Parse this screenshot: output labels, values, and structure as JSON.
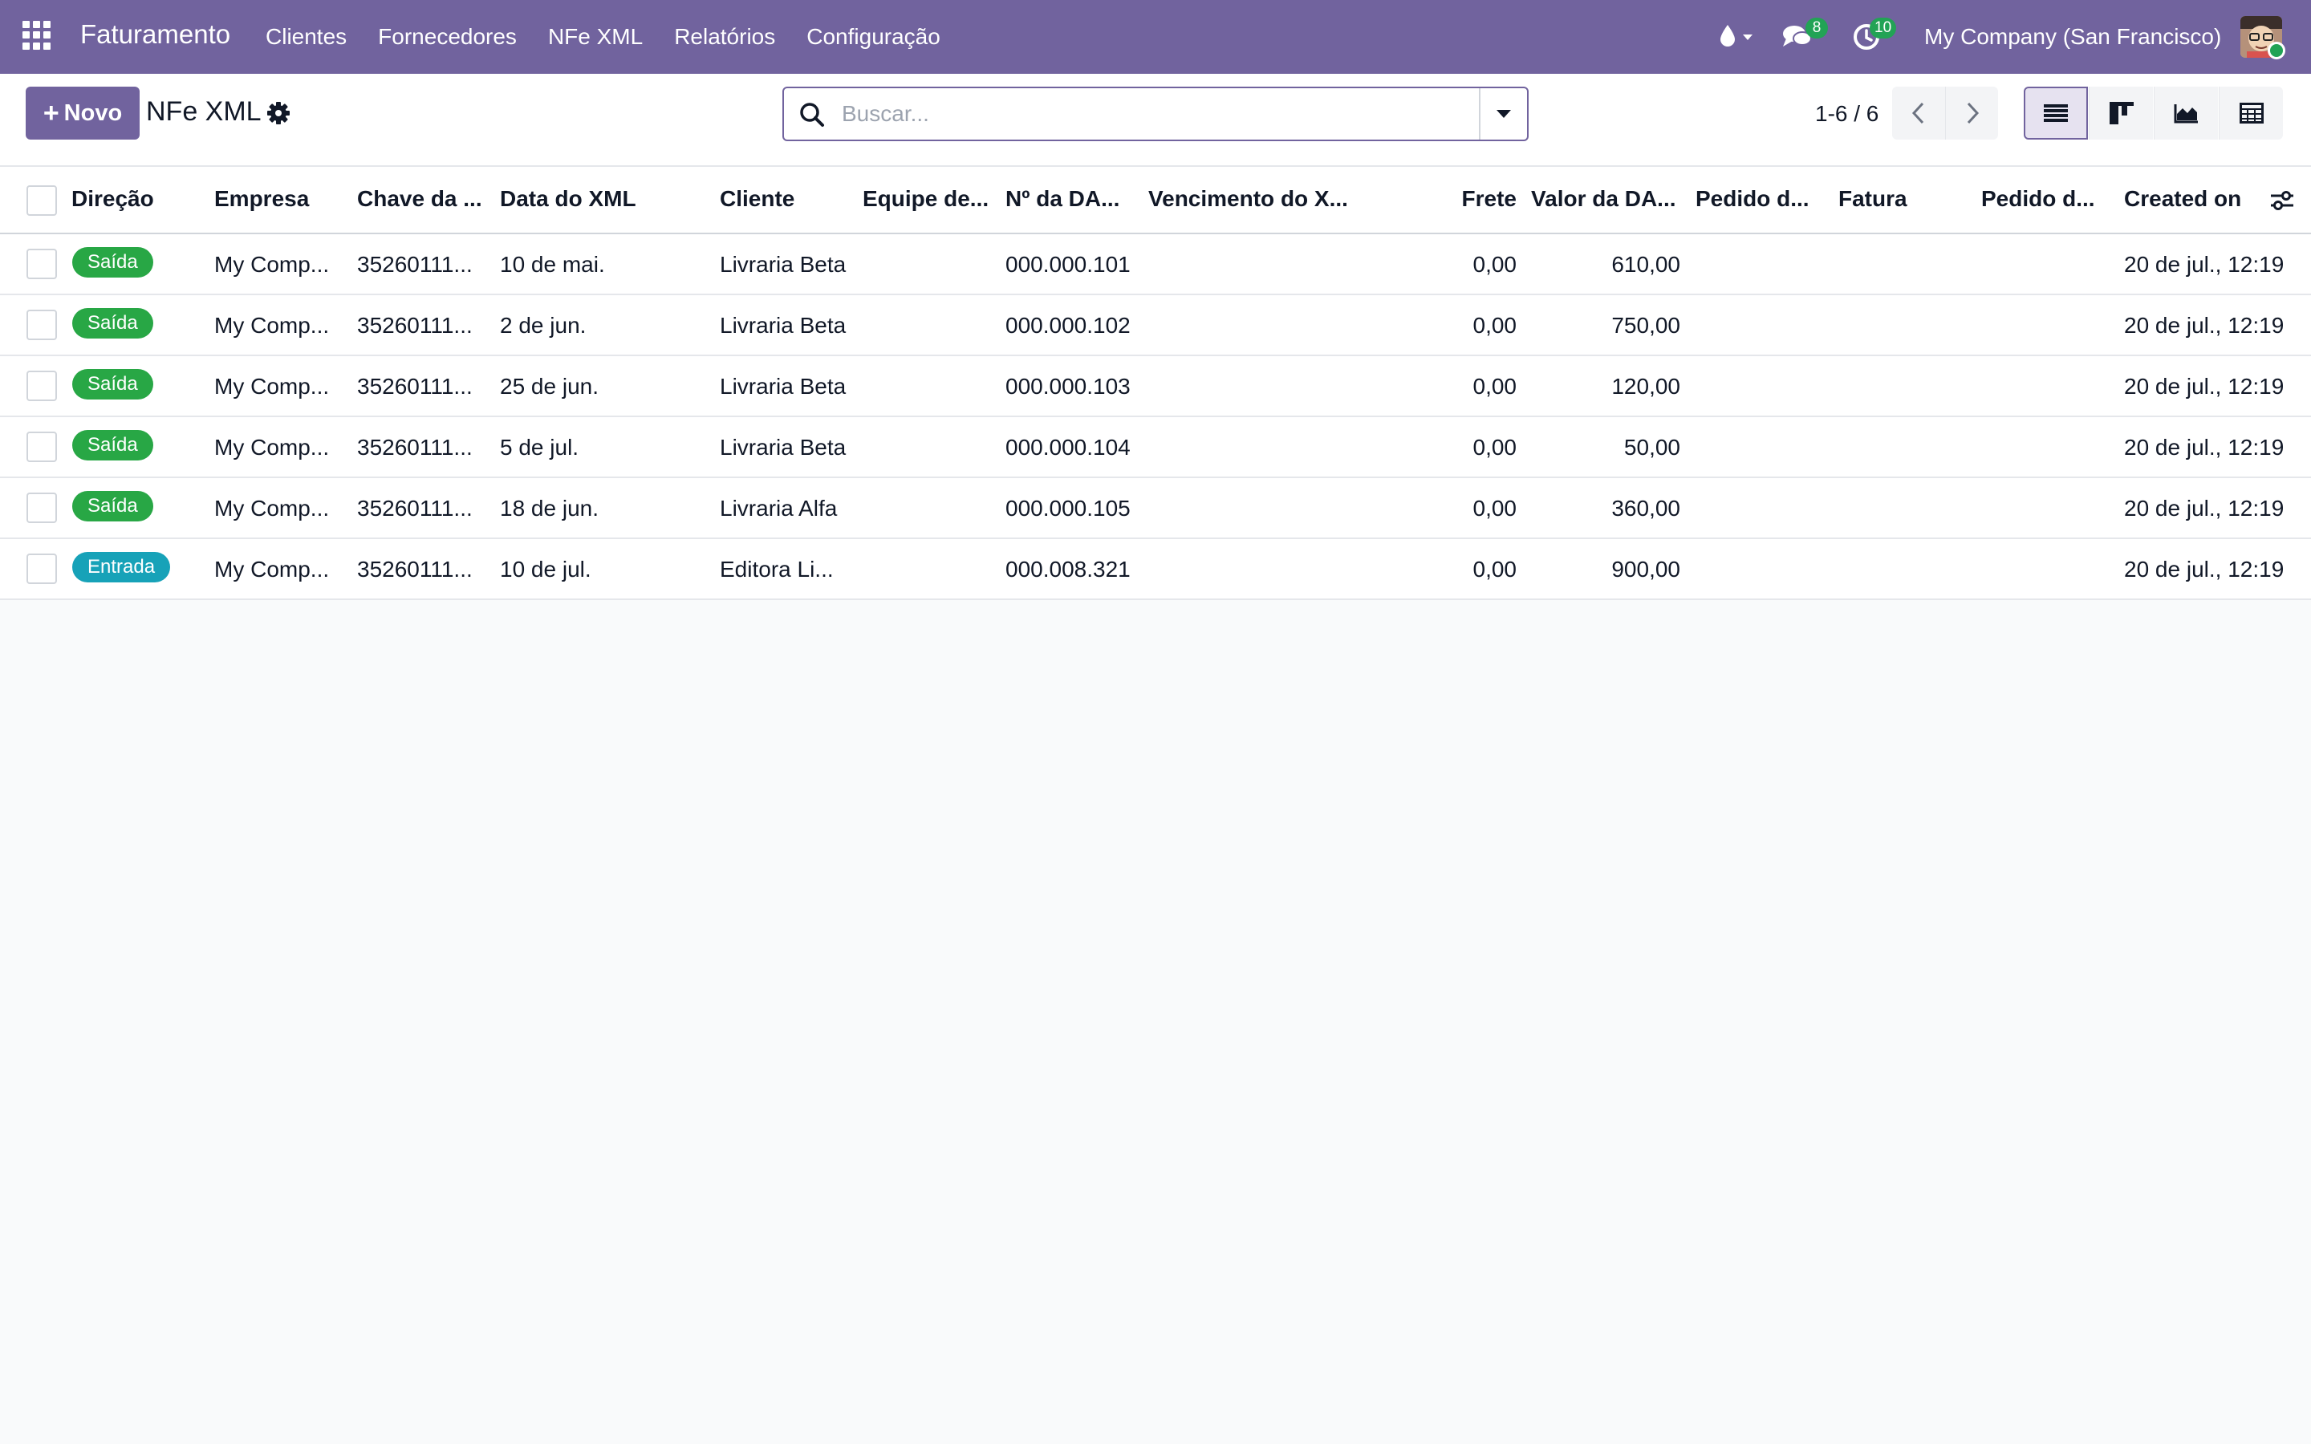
{
  "navbar": {
    "brand": "Faturamento",
    "menu": [
      "Clientes",
      "Fornecedores",
      "NFe XML",
      "Relatórios",
      "Configuração"
    ],
    "messages_count": "8",
    "activities_count": "10",
    "company": "My Company (San Francisco)",
    "icons": [
      "apps-icon",
      "drop-icon",
      "chat-icon",
      "clock-icon",
      "avatar"
    ],
    "accent_color": "#71639e"
  },
  "control": {
    "new_label": "Novo",
    "title": "NFe XML",
    "search_placeholder": "Buscar...",
    "pager": "1-6 / 6"
  },
  "table": {
    "columns": [
      "Direção",
      "Empresa",
      "Chave da ...",
      "Data do XML",
      "Cliente",
      "Equipe de...",
      "Nº da DA...",
      "Vencimento do X...",
      "Frete",
      "Valor da DA...",
      "Pedido d...",
      "Fatura",
      "Pedido d...",
      "Created on"
    ],
    "rows": [
      {
        "direcao": "Saída",
        "empresa": "My Comp...",
        "chave": "35260111...",
        "data": "10 de mai.",
        "cliente": "Livraria Beta",
        "numero": "000.000.101",
        "frete": "0,00",
        "valor": "610,00",
        "created": "20 de jul., 12:19"
      },
      {
        "direcao": "Saída",
        "empresa": "My Comp...",
        "chave": "35260111...",
        "data": "2 de jun.",
        "cliente": "Livraria Beta",
        "numero": "000.000.102",
        "frete": "0,00",
        "valor": "750,00",
        "created": "20 de jul., 12:19"
      },
      {
        "direcao": "Saída",
        "empresa": "My Comp...",
        "chave": "35260111...",
        "data": "25 de jun.",
        "cliente": "Livraria Beta",
        "numero": "000.000.103",
        "frete": "0,00",
        "valor": "120,00",
        "created": "20 de jul., 12:19"
      },
      {
        "direcao": "Saída",
        "empresa": "My Comp...",
        "chave": "35260111...",
        "data": "5 de jul.",
        "cliente": "Livraria Beta",
        "numero": "000.000.104",
        "frete": "0,00",
        "valor": "50,00",
        "created": "20 de jul., 12:19"
      },
      {
        "direcao": "Saída",
        "empresa": "My Comp...",
        "chave": "35260111...",
        "data": "18 de jun.",
        "cliente": "Livraria Alfa",
        "numero": "000.000.105",
        "frete": "0,00",
        "valor": "360,00",
        "created": "20 de jul., 12:19"
      },
      {
        "direcao": "Entrada",
        "empresa": "My Comp...",
        "chave": "35260111...",
        "data": "10 de jul.",
        "cliente": "Editora Li...",
        "numero": "000.008.321",
        "frete": "0,00",
        "valor": "900,00",
        "created": "20 de jul., 12:19"
      }
    ]
  }
}
